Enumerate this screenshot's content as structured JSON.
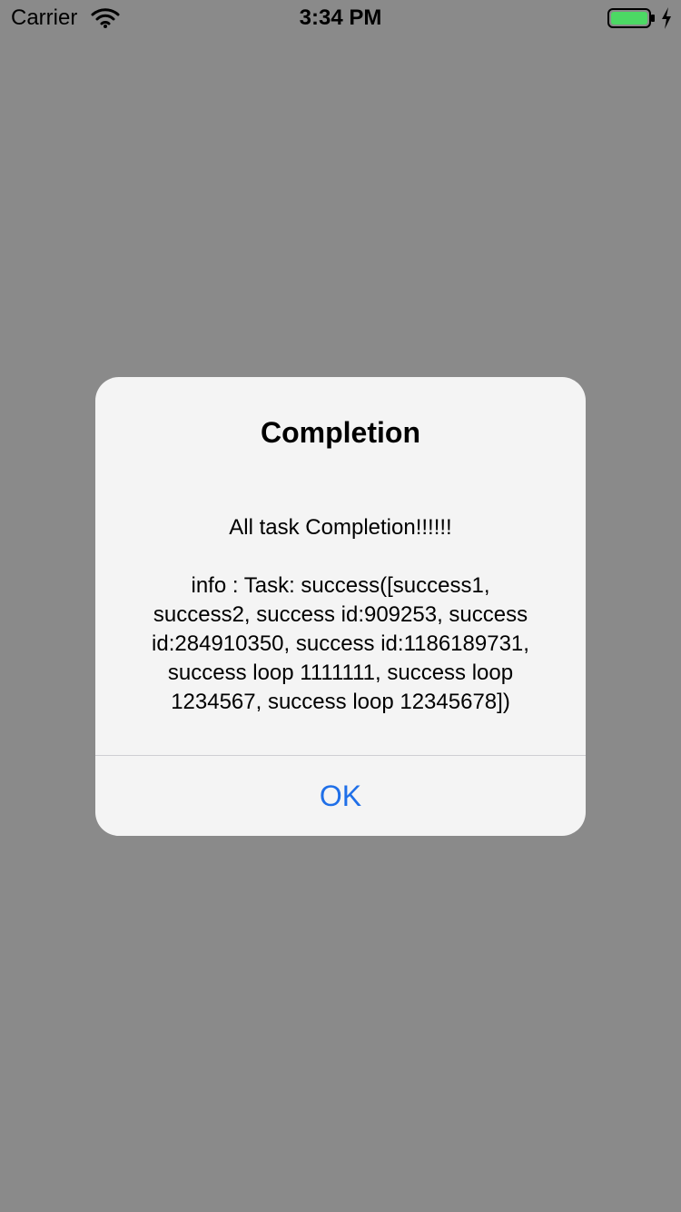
{
  "status_bar": {
    "carrier": "Carrier",
    "time": "3:34 PM",
    "wifi_icon": "wifi-icon",
    "battery_icon": "battery-icon",
    "charging_icon": "bolt-icon",
    "battery_color": "#4cd964"
  },
  "overlay": {
    "background_color": "#8a8a8a"
  },
  "alert": {
    "title": "Completion",
    "message": "All task Completion!!!!!!\n\ninfo : Task: success([success1,\nsuccess2, success id:909253, success\nid:284910350, success id:1186189731,\nsuccess loop 1111111, success loop\n1234567, success loop 12345678])",
    "ok_label": "OK",
    "button_color": "#1f6fe8"
  }
}
